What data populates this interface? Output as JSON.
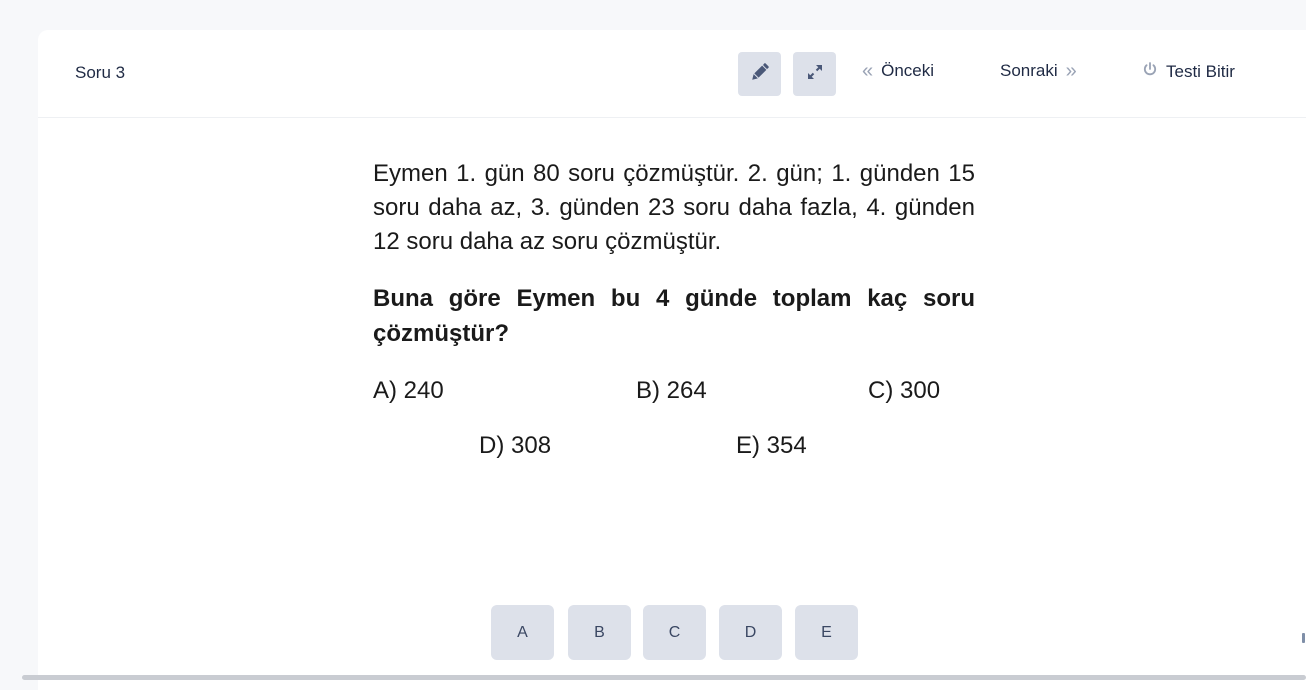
{
  "header": {
    "title": "Soru 3",
    "prev_label": "Önceki",
    "next_label": "Sonraki",
    "finish_label": "Testi Bitir"
  },
  "question": {
    "text": "Eymen 1. gün 80 soru çözmüştür. 2. gün; 1. gün­den 15 soru daha az, 3. günden 23 soru daha fazla, 4. günden 12 soru daha az soru çözmüştür.",
    "prompt": "Buna göre Eymen bu 4 günde toplam kaç soru çözmüştür?",
    "options": [
      {
        "label": "A) 240"
      },
      {
        "label": "B) 264"
      },
      {
        "label": "C) 300"
      },
      {
        "label": "D) 308"
      },
      {
        "label": "E) 354"
      }
    ]
  },
  "answer_buttons": [
    "A",
    "B",
    "C",
    "D",
    "E"
  ],
  "icons": {
    "pencil": "pencil-icon",
    "expand": "expand-icon",
    "prev": "double-chevron-left-icon",
    "next": "double-chevron-right-icon",
    "finish": "power-icon"
  },
  "colors": {
    "button_bg": "#dde1ea",
    "text_dark": "#1f2a44",
    "icon_gray": "#9aa3b5",
    "page_bg": "#f7f8fa"
  }
}
